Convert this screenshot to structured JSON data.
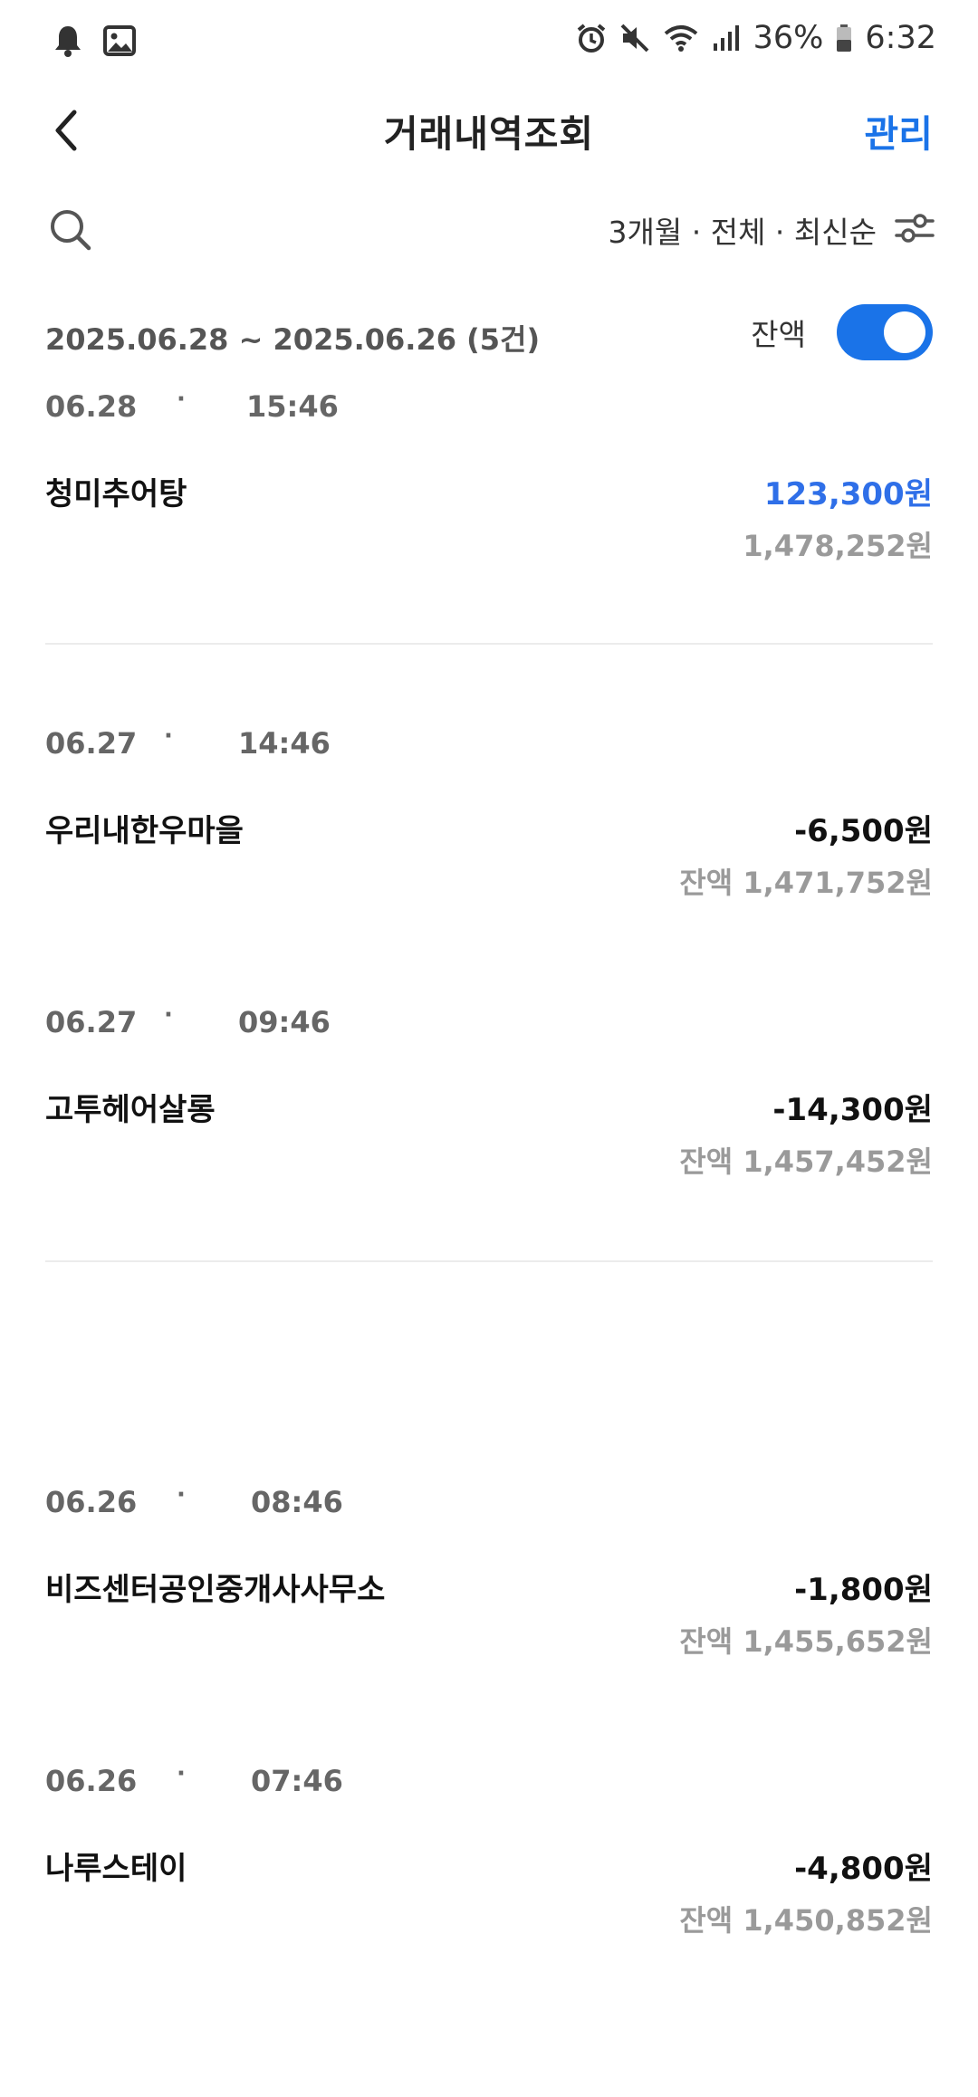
{
  "status_bar": {
    "left_icons": [
      "notification-bell-icon",
      "gallery-icon"
    ],
    "right_icons": [
      "alarm-icon",
      "mute-icon",
      "wifi-icon",
      "signal-icon"
    ],
    "battery": "36%",
    "time": "6:32"
  },
  "header": {
    "title": "거래내역조회",
    "back_icon": "chevron-left-icon",
    "manage_label": "관리"
  },
  "filter": {
    "search_icon": "search-icon",
    "summary": "3개월 · 전체 · 최신순",
    "filter_icon": "slider-filter-icon"
  },
  "summary": {
    "range": "2025.06.28 ~ 2025.06.26 (5건)",
    "balance_label": "잔액",
    "balance_toggle_on": true
  },
  "colors": {
    "accent": "#1a73e8",
    "deposit": "#2f6fe8",
    "muted": "#9a9a9a"
  },
  "transactions": [
    {
      "date": "06.28",
      "time": "15:46",
      "name": "청미추어탕",
      "amount": "123,300원",
      "balance": "1,478,252원",
      "type": "deposit"
    },
    {
      "date": "06.27",
      "time": "14:46",
      "name": "우리내한우마을",
      "amount": "-6,500원",
      "balance": "잔액 1,471,752원",
      "type": "withdrawal"
    },
    {
      "date": "06.27",
      "time": "09:46",
      "name": "고투헤어살롱",
      "amount": "-14,300원",
      "balance": "잔액 1,457,452원",
      "type": "withdrawal"
    },
    {
      "date": "06.26",
      "time": "08:46",
      "name": "비즈센터공인중개사사무소",
      "amount": "-1,800원",
      "balance": "잔액 1,455,652원",
      "type": "withdrawal"
    },
    {
      "date": "06.26",
      "time": "07:46",
      "name": "나루스테이",
      "amount": "-4,800원",
      "balance": "잔액 1,450,852원",
      "type": "withdrawal"
    }
  ]
}
